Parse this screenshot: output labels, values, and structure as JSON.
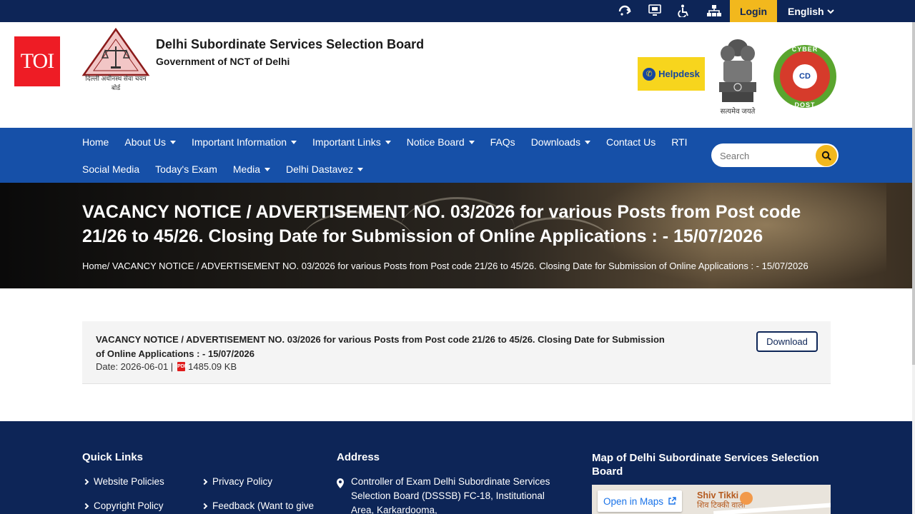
{
  "topbar": {
    "login_label": "Login",
    "language_label": "English",
    "icons": [
      "screen-reader-icon",
      "sitemap-monitor-icon",
      "accessibility-icon",
      "hierarchy-icon"
    ]
  },
  "header": {
    "toi_logo": "TOI",
    "org_title": "Delhi Subordinate Services Selection Board",
    "org_subtitle": "Government of NCT of Delhi",
    "emblem_caption": "दिल्ली अधीनस्थ सेवा चयन बोर्ड",
    "helpdesk_label": "Helpdesk",
    "ashoka_caption": "सत्यमेव जयते",
    "cyber_top": "CYBER",
    "cyber_center": "CD",
    "cyber_bottom": "DOST"
  },
  "nav": {
    "row1": [
      {
        "label": "Home",
        "dropdown": false
      },
      {
        "label": "About Us",
        "dropdown": true
      },
      {
        "label": "Important Information",
        "dropdown": true
      },
      {
        "label": "Important Links",
        "dropdown": true
      },
      {
        "label": "Notice Board",
        "dropdown": true
      },
      {
        "label": "FAQs",
        "dropdown": false
      },
      {
        "label": "Downloads",
        "dropdown": true
      },
      {
        "label": "Contact Us",
        "dropdown": false
      },
      {
        "label": "RTI",
        "dropdown": false
      }
    ],
    "row2": [
      {
        "label": "Social Media",
        "dropdown": false
      },
      {
        "label": "Today's Exam",
        "dropdown": false
      },
      {
        "label": "Media",
        "dropdown": true
      },
      {
        "label": "Delhi Dastavez",
        "dropdown": true
      }
    ],
    "search_placeholder": "Search"
  },
  "hero": {
    "title": "VACANCY NOTICE / ADVERTISEMENT NO. 03/2026 for various Posts from Post code 21/26 to 45/26. Closing Date for Submission of Online Applications : - 15/07/2026",
    "breadcrumb": "Home/ VACANCY NOTICE / ADVERTISEMENT NO. 03/2026 for various Posts from Post code 21/26 to 45/26. Closing Date for Submission of Online Applications : - 15/07/2026"
  },
  "notice": {
    "title": "VACANCY NOTICE / ADVERTISEMENT NO. 03/2026 for various Posts from Post code 21/26 to 45/26. Closing Date for Submission of Online Applications : - 15/07/2026",
    "date": "Date: 2026-06-01 |",
    "file_size": "1485.09 KB",
    "download_label": "Download",
    "pdf_glyph": "PDF"
  },
  "footer": {
    "quick_links_heading": "Quick Links",
    "links": [
      "Website Policies",
      "Privacy Policy",
      "Copyright Policy",
      "Feedback (Want to give"
    ],
    "address_heading": "Address",
    "address": "Controller of Exam Delhi Subordinate Services Selection Board (DSSSB) FC-18, Institutional Area, Karkardooma,",
    "map_heading": "Map of Delhi Subordinate Services Selection Board",
    "map_open_label": "Open in Maps",
    "map_place": "Shiv Tikki",
    "map_place_sub": "शिव टिक्की वाला"
  }
}
